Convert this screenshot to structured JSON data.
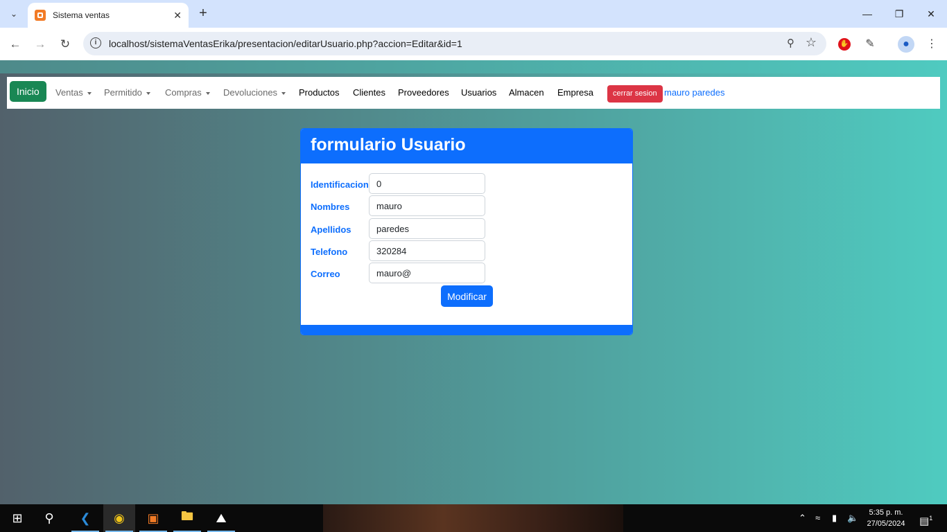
{
  "browser": {
    "tab_title": "Sistema ventas",
    "url": "localhost/sistemaVentasErika/presentacion/editarUsuario.php?accion=Editar&id=1"
  },
  "nav": {
    "brand": "Inicio",
    "items": [
      {
        "label": "Ventas",
        "dropdown": true
      },
      {
        "label": "Permitido",
        "dropdown": true
      },
      {
        "label": "Compras",
        "dropdown": true
      },
      {
        "label": "Devoluciones",
        "dropdown": true
      },
      {
        "label": "Productos",
        "dropdown": false
      },
      {
        "label": "Clientes",
        "dropdown": false
      },
      {
        "label": "Proveedores",
        "dropdown": false
      },
      {
        "label": "Usuarios",
        "dropdown": false
      },
      {
        "label": "Almacen",
        "dropdown": false
      },
      {
        "label": "Empresa",
        "dropdown": false
      }
    ],
    "logout": "cerrar sesion",
    "user": "mauro paredes"
  },
  "form": {
    "title": "formulario Usuario",
    "fields": [
      {
        "label": "Identificacion",
        "value": "0"
      },
      {
        "label": "Nombres",
        "value": "mauro"
      },
      {
        "label": "Apellidos",
        "value": "paredes"
      },
      {
        "label": "Telefono",
        "value": "320284"
      },
      {
        "label": "Correo",
        "value": "mauro@"
      }
    ],
    "submit": "Modificar"
  },
  "taskbar": {
    "time": "5:35 p. m.",
    "date": "27/05/2024",
    "notifications": "1"
  },
  "colors": {
    "primary": "#0d6efd",
    "brand": "#198754",
    "danger": "#dc3545"
  }
}
